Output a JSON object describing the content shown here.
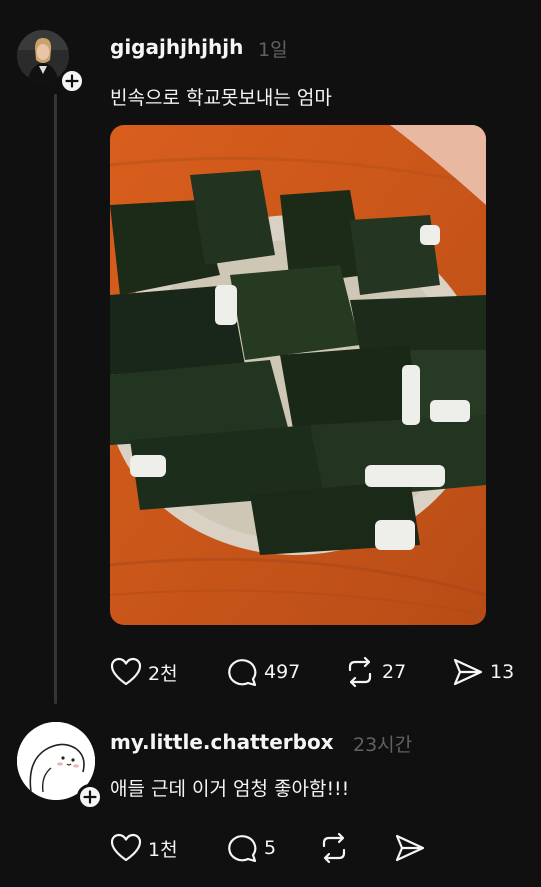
{
  "post1": {
    "username": "gigajhjhjhjh",
    "time": "1일",
    "text": "빈속으로 학교못보내는 엄마",
    "actions": {
      "like_count": "2천",
      "comment_count": "497",
      "repost_count": "27",
      "share_count": "13"
    }
  },
  "reply": {
    "username": "my.little.chatterbox",
    "time": "23시간",
    "text": "애들 근데 이거 엄청 좋아함!!!",
    "actions": {
      "like_count": "1천",
      "comment_count": "5"
    }
  },
  "icons": {
    "follow": "plus-icon",
    "like": "heart-icon",
    "comment": "speech-bubble-icon",
    "repost": "repost-icon",
    "share": "send-icon"
  },
  "colors": {
    "background": "#101010",
    "text_primary": "#f3f5f7",
    "text_secondary": "#616161",
    "thread_line": "#333638"
  }
}
